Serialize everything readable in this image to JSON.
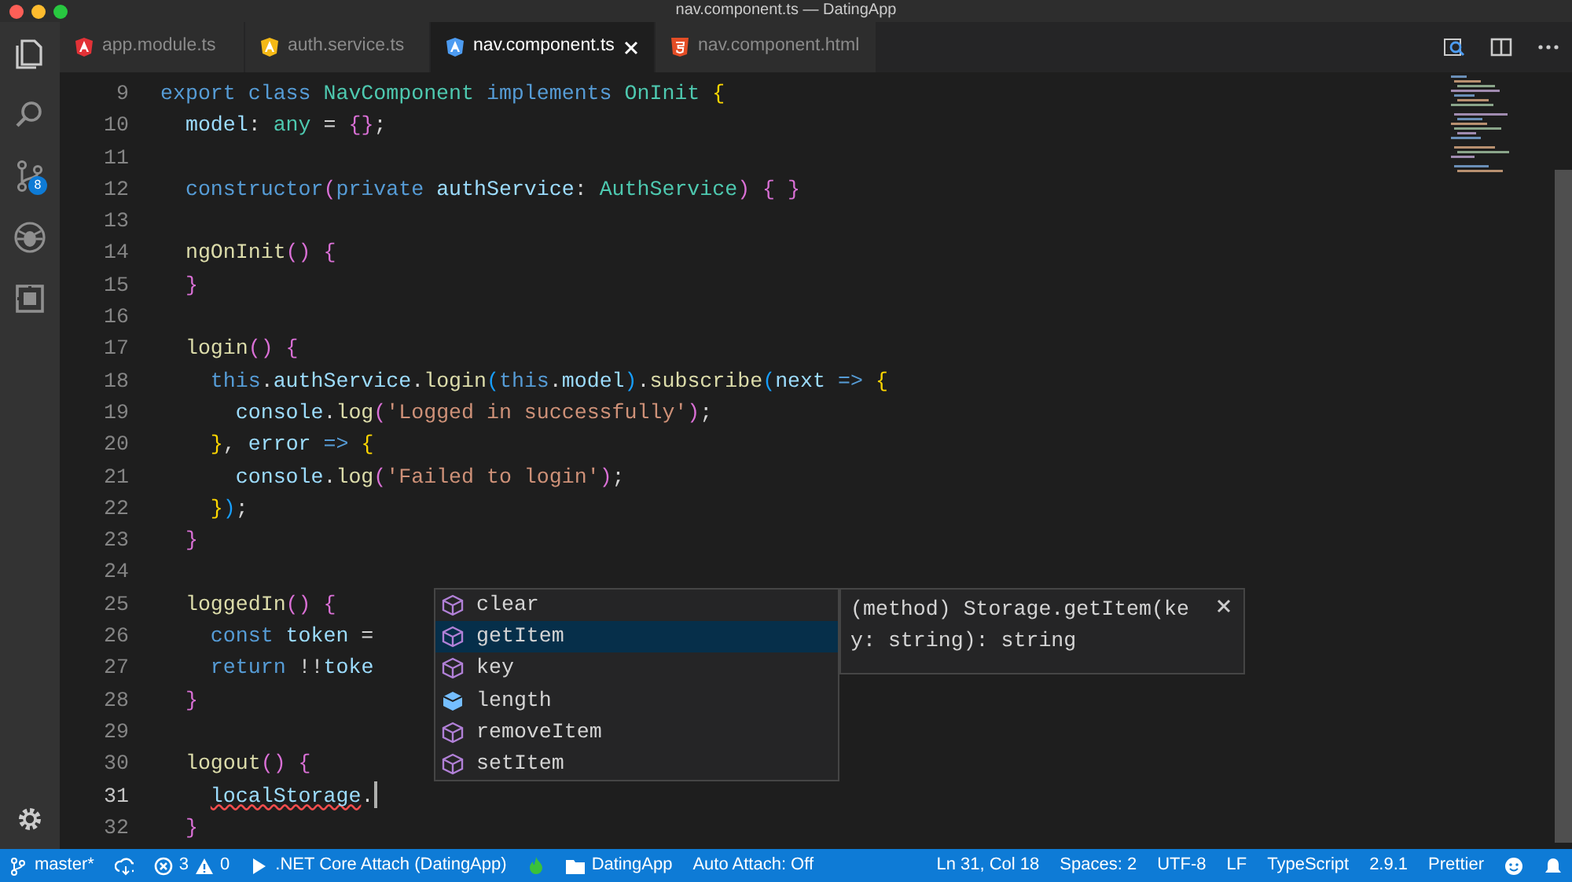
{
  "window": {
    "title": "nav.component.ts — DatingApp"
  },
  "activity_bar": {
    "items": [
      {
        "kind": "files",
        "selected": true
      },
      {
        "kind": "search",
        "selected": false
      },
      {
        "kind": "scm",
        "selected": false,
        "badge": "8"
      },
      {
        "kind": "debug",
        "selected": false
      },
      {
        "kind": "extensions",
        "selected": false
      }
    ]
  },
  "tabs": [
    {
      "label": "app.module.ts",
      "kind": "angular",
      "color": "#e23237",
      "selected": false,
      "closable": false
    },
    {
      "label": "auth.service.ts",
      "kind": "angular",
      "color": "#f5b916",
      "selected": false,
      "closable": false
    },
    {
      "label": "nav.component.ts",
      "kind": "angular",
      "color": "#4d9cf2",
      "selected": true,
      "closable": true
    },
    {
      "label": "nav.component.html",
      "kind": "html",
      "color": "#e44d26",
      "selected": false,
      "closable": false
    }
  ],
  "editor": {
    "lines": [
      {
        "number": "9",
        "current": false,
        "tokens": [
          {
            "kind": "kw",
            "text": "export class "
          },
          {
            "kind": "type",
            "text": "NavComponent "
          },
          {
            "kind": "kw",
            "text": "implements "
          },
          {
            "kind": "type",
            "text": "OnInit "
          },
          {
            "kind": "b1",
            "text": "{"
          }
        ]
      },
      {
        "number": "10",
        "current": false,
        "tokens": [
          {
            "kind": "var",
            "text": "  model"
          },
          {
            "kind": "p",
            "text": ": "
          },
          {
            "kind": "type",
            "text": "any"
          },
          {
            "kind": "p",
            "text": " = "
          },
          {
            "kind": "b2",
            "text": "{}"
          },
          {
            "kind": "p",
            "text": ";"
          }
        ]
      },
      {
        "number": "11",
        "current": false
      },
      {
        "number": "12",
        "current": false,
        "tokens": [
          {
            "kind": "kw",
            "text": "  constructor"
          },
          {
            "kind": "b2",
            "text": "("
          },
          {
            "kind": "kw",
            "text": "private "
          },
          {
            "kind": "var",
            "text": "authService"
          },
          {
            "kind": "p",
            "text": ": "
          },
          {
            "kind": "type",
            "text": "AuthService"
          },
          {
            "kind": "b2",
            "text": ") { }"
          }
        ]
      },
      {
        "number": "13",
        "current": false
      },
      {
        "number": "14",
        "current": false,
        "tokens": [
          {
            "kind": "fn",
            "text": "  ngOnInit"
          },
          {
            "kind": "b2",
            "text": "() {"
          }
        ]
      },
      {
        "number": "15",
        "current": false,
        "tokens": [
          {
            "kind": "b2",
            "text": "  }"
          }
        ]
      },
      {
        "number": "16",
        "current": false
      },
      {
        "number": "17",
        "current": false,
        "tokens": [
          {
            "kind": "fn",
            "text": "  login"
          },
          {
            "kind": "b2",
            "text": "() {"
          }
        ]
      },
      {
        "number": "18",
        "current": false,
        "tokens": [
          {
            "kind": "kw",
            "text": "    this"
          },
          {
            "kind": "p",
            "text": "."
          },
          {
            "kind": "var",
            "text": "authService"
          },
          {
            "kind": "p",
            "text": "."
          },
          {
            "kind": "fn",
            "text": "login"
          },
          {
            "kind": "b3",
            "text": "("
          },
          {
            "kind": "kw",
            "text": "this"
          },
          {
            "kind": "p",
            "text": "."
          },
          {
            "kind": "var",
            "text": "model"
          },
          {
            "kind": "b3",
            "text": ")"
          },
          {
            "kind": "p",
            "text": "."
          },
          {
            "kind": "fn",
            "text": "subscribe"
          },
          {
            "kind": "b3",
            "text": "("
          },
          {
            "kind": "var",
            "text": "next "
          },
          {
            "kind": "kw",
            "text": "=> "
          },
          {
            "kind": "b1",
            "text": "{"
          }
        ]
      },
      {
        "number": "19",
        "current": false,
        "tokens": [
          {
            "kind": "var",
            "text": "      console"
          },
          {
            "kind": "p",
            "text": "."
          },
          {
            "kind": "fn",
            "text": "log"
          },
          {
            "kind": "b2",
            "text": "("
          },
          {
            "kind": "str",
            "text": "'Logged in successfully'"
          },
          {
            "kind": "b2",
            "text": ")"
          },
          {
            "kind": "p",
            "text": ";"
          }
        ]
      },
      {
        "number": "20",
        "current": false,
        "tokens": [
          {
            "kind": "b1",
            "text": "    }"
          },
          {
            "kind": "p",
            "text": ", "
          },
          {
            "kind": "var",
            "text": "error "
          },
          {
            "kind": "kw",
            "text": "=> "
          },
          {
            "kind": "b1",
            "text": "{"
          }
        ]
      },
      {
        "number": "21",
        "current": false,
        "tokens": [
          {
            "kind": "var",
            "text": "      console"
          },
          {
            "kind": "p",
            "text": "."
          },
          {
            "kind": "fn",
            "text": "log"
          },
          {
            "kind": "b2",
            "text": "("
          },
          {
            "kind": "str",
            "text": "'Failed to login'"
          },
          {
            "kind": "b2",
            "text": ")"
          },
          {
            "kind": "p",
            "text": ";"
          }
        ]
      },
      {
        "number": "22",
        "current": false,
        "tokens": [
          {
            "kind": "b1",
            "text": "    }"
          },
          {
            "kind": "b3",
            "text": ")"
          },
          {
            "kind": "p",
            "text": ";"
          }
        ]
      },
      {
        "number": "23",
        "current": false,
        "tokens": [
          {
            "kind": "b2",
            "text": "  }"
          }
        ]
      },
      {
        "number": "24",
        "current": false
      },
      {
        "number": "25",
        "current": false,
        "tokens": [
          {
            "kind": "fn",
            "text": "  loggedIn"
          },
          {
            "kind": "b2",
            "text": "() {"
          }
        ]
      },
      {
        "number": "26",
        "current": false,
        "tokens": [
          {
            "kind": "kw",
            "text": "    const "
          },
          {
            "kind": "var",
            "text": "token"
          },
          {
            "kind": "p",
            "text": " ="
          }
        ]
      },
      {
        "number": "27",
        "current": false,
        "tokens": [
          {
            "kind": "kw",
            "text": "    return "
          },
          {
            "kind": "p",
            "text": "!!"
          },
          {
            "kind": "var",
            "text": "toke"
          }
        ]
      },
      {
        "number": "28",
        "current": false,
        "tokens": [
          {
            "kind": "b2",
            "text": "  }"
          }
        ]
      },
      {
        "number": "29",
        "current": false
      },
      {
        "number": "30",
        "current": false,
        "tokens": [
          {
            "kind": "fn",
            "text": "  logout"
          },
          {
            "kind": "b2",
            "text": "() {"
          }
        ]
      },
      {
        "number": "31",
        "current": true,
        "tokens": [
          {
            "kind": "err",
            "text": "    localStorage"
          },
          {
            "kind": "p",
            "text": "."
          }
        ]
      },
      {
        "number": "32",
        "current": false,
        "tokens": [
          {
            "kind": "b2",
            "text": "  }"
          }
        ]
      }
    ]
  },
  "suggestions": {
    "items": [
      {
        "label": "clear",
        "kind": "method",
        "selected": false
      },
      {
        "label": "getItem",
        "kind": "method",
        "selected": true
      },
      {
        "label": "key",
        "kind": "method",
        "selected": false
      },
      {
        "label": "length",
        "kind": "property",
        "selected": false
      },
      {
        "label": "removeItem",
        "kind": "method",
        "selected": false
      },
      {
        "label": "setItem",
        "kind": "method",
        "selected": false
      }
    ],
    "detail": [
      "(method) Storage.getItem(ke",
      "y: string): string"
    ]
  },
  "status_bar": {
    "left": [
      {
        "kind": "branch",
        "text": "master*"
      },
      {
        "kind": "sync"
      },
      {
        "kind": "problems",
        "errors": "3",
        "warnings": "0"
      },
      {
        "kind": "play",
        "text": ".NET Core Attach (DatingApp)"
      },
      {
        "kind": "flame"
      },
      {
        "kind": "folder",
        "text": "DatingApp"
      },
      {
        "kind": "plain",
        "text": "Auto Attach: Off"
      }
    ],
    "right": [
      {
        "kind": "plain",
        "text": "Ln 31, Col 18"
      },
      {
        "kind": "plain",
        "text": "Spaces: 2"
      },
      {
        "kind": "plain",
        "text": "UTF-8"
      },
      {
        "kind": "plain",
        "text": "LF"
      },
      {
        "kind": "plain",
        "text": "TypeScript"
      },
      {
        "kind": "plain",
        "text": "2.9.1"
      },
      {
        "kind": "plain",
        "text": "Prettier"
      },
      {
        "kind": "smiley"
      }
    ]
  }
}
